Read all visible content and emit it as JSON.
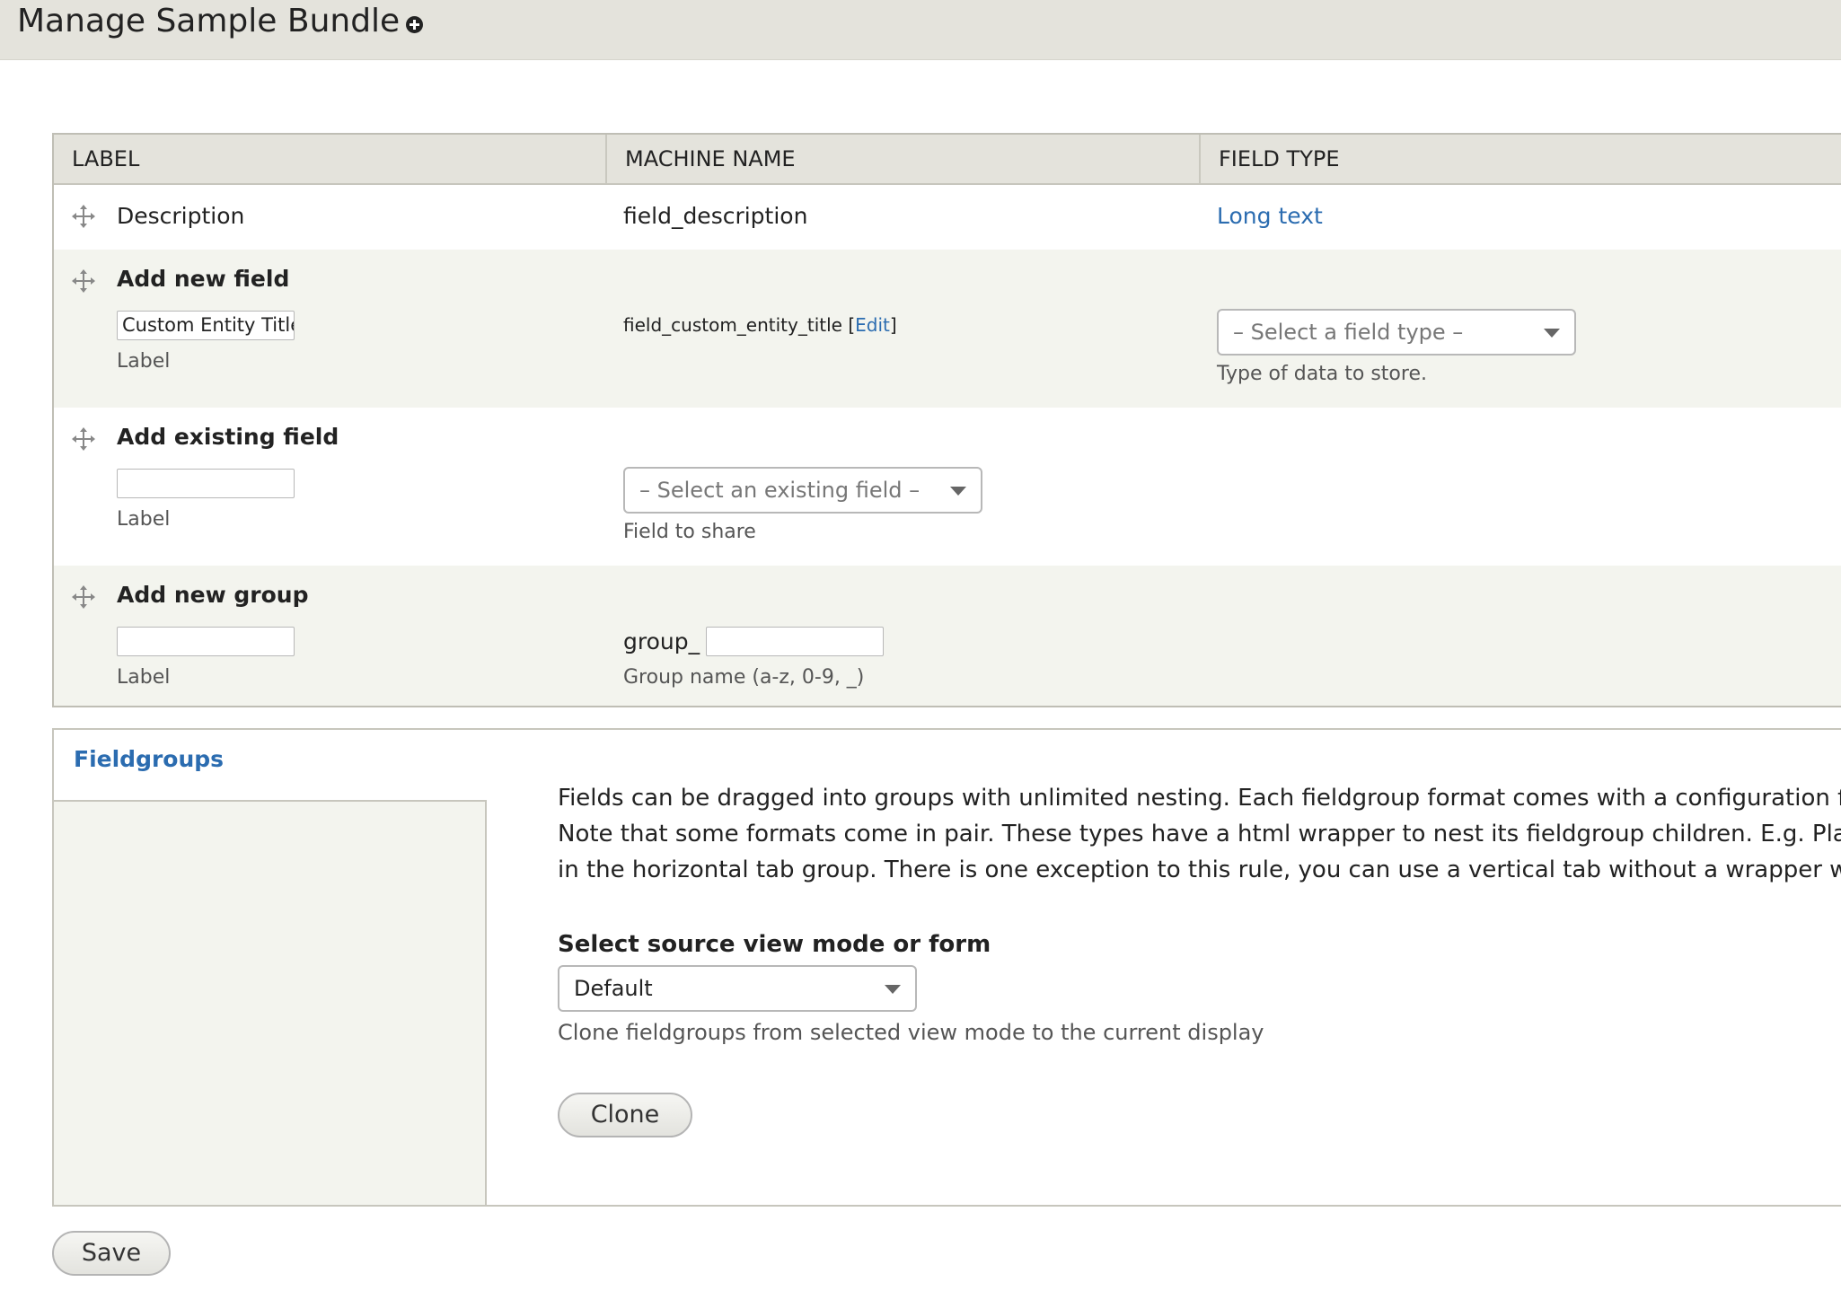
{
  "page": {
    "title": "Manage Sample Bundle"
  },
  "table": {
    "headers": {
      "label": "LABEL",
      "machine_name": "MACHINE NAME",
      "field_type": "FIELD TYPE"
    },
    "rows": {
      "description": {
        "label": "Description",
        "machine_name": "field_description",
        "field_type": "Long text"
      },
      "add_new_field": {
        "title": "Add new field",
        "label_value": "Custom Entity Title",
        "label_caption": "Label",
        "machine_name": "field_custom_entity_title",
        "edit_open": "[",
        "edit_link": "Edit",
        "edit_close": "]",
        "select_placeholder": "– Select a field type –",
        "select_help": "Type of data to store."
      },
      "add_existing_field": {
        "title": "Add existing field",
        "label_value": "",
        "label_caption": "Label",
        "select_placeholder": "– Select an existing field –",
        "select_help": "Field to share"
      },
      "add_new_group": {
        "title": "Add new group",
        "label_value": "",
        "label_caption": "Label",
        "group_prefix": "group_",
        "group_value": "",
        "group_help": "Group name (a-z, 0-9, _)"
      }
    }
  },
  "fieldgroups": {
    "title": "Fieldgroups",
    "description": "Fields can be dragged into groups with unlimited nesting. Each fieldgroup format comes with a configuration form\nNote that some formats come in pair. These types have a html wrapper to nest its fieldgroup children. E.g. Place a\nin the horizontal tab group. There is one exception to this rule, you can use a vertical tab without a wrapper when",
    "select_label": "Select source view mode or form",
    "select_value": "Default",
    "select_help": "Clone fieldgroups from selected view mode to the current display",
    "clone_button": "Clone"
  },
  "actions": {
    "save_button": "Save"
  },
  "colors": {
    "header_bg": "#e4e3dc",
    "row_alt_bg": "#f3f4ee",
    "link": "#2b6cb0"
  },
  "icons": {
    "drag": "drag-handle-icon",
    "shortcut": "add-shortcut-icon",
    "dropdown": "chevron-down-icon"
  }
}
